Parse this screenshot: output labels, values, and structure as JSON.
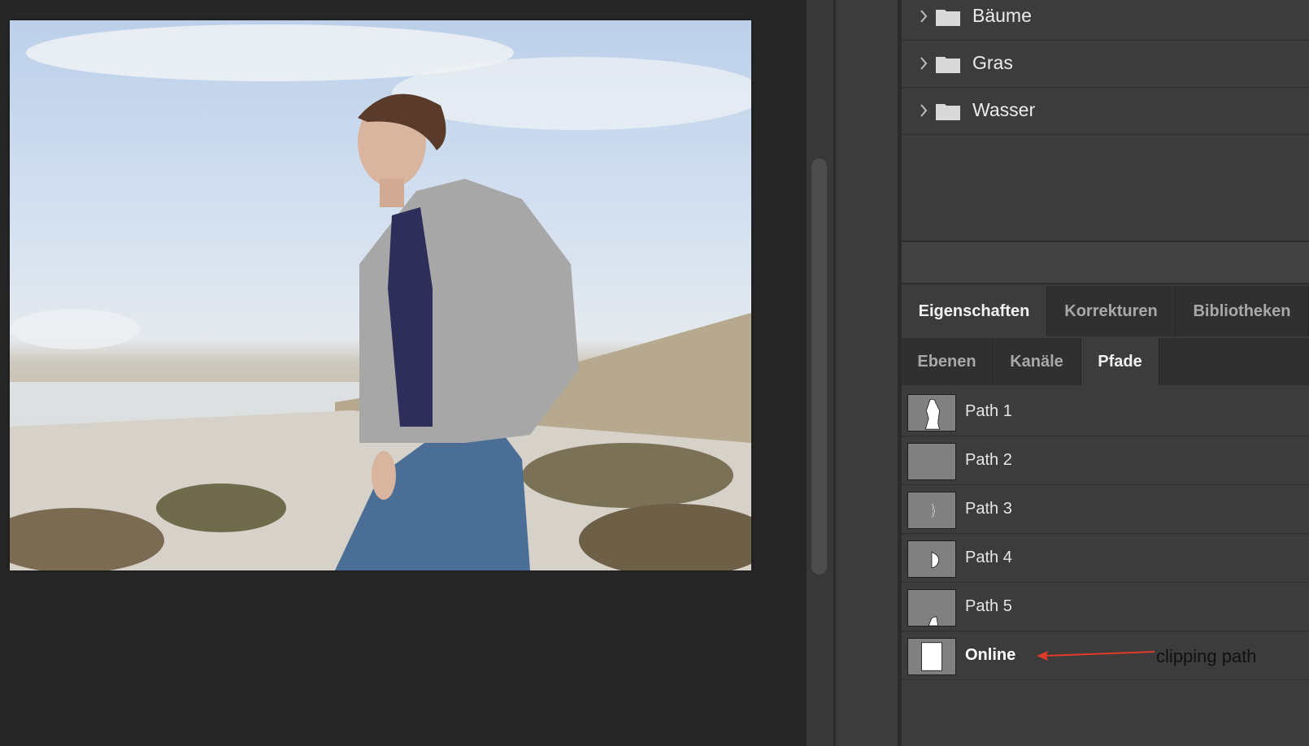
{
  "layers_panel": {
    "folders": [
      {
        "label": "Bäume",
        "icon": "folder-icon"
      },
      {
        "label": "Gras",
        "icon": "folder-icon"
      },
      {
        "label": "Wasser",
        "icon": "folder-icon"
      }
    ]
  },
  "properties_tabs": {
    "items": [
      {
        "label": "Eigenschaften",
        "active": true
      },
      {
        "label": "Korrekturen",
        "active": false
      },
      {
        "label": "Bibliotheken",
        "active": false
      }
    ]
  },
  "layer_tabs": {
    "items": [
      {
        "label": "Ebenen",
        "active": false
      },
      {
        "label": "Kanäle",
        "active": false
      },
      {
        "label": "Pfade",
        "active": true
      }
    ]
  },
  "paths": [
    {
      "label": "Path 1",
      "thumb": "person-silhouette"
    },
    {
      "label": "Path 2",
      "thumb": "empty"
    },
    {
      "label": "Path 3",
      "thumb": "thin-sliver"
    },
    {
      "label": "Path 4",
      "thumb": "small-shape"
    },
    {
      "label": "Path 5",
      "thumb": "hand-shape"
    },
    {
      "label": "Online",
      "thumb": "white-rectangle",
      "bold": true
    }
  ],
  "annotation": {
    "text": "clipping path",
    "color": "#e03a2a"
  },
  "colors": {
    "panel_bg": "#3c3c3c",
    "tab_bar_bg": "#303030",
    "canvas_bg": "#262626"
  }
}
